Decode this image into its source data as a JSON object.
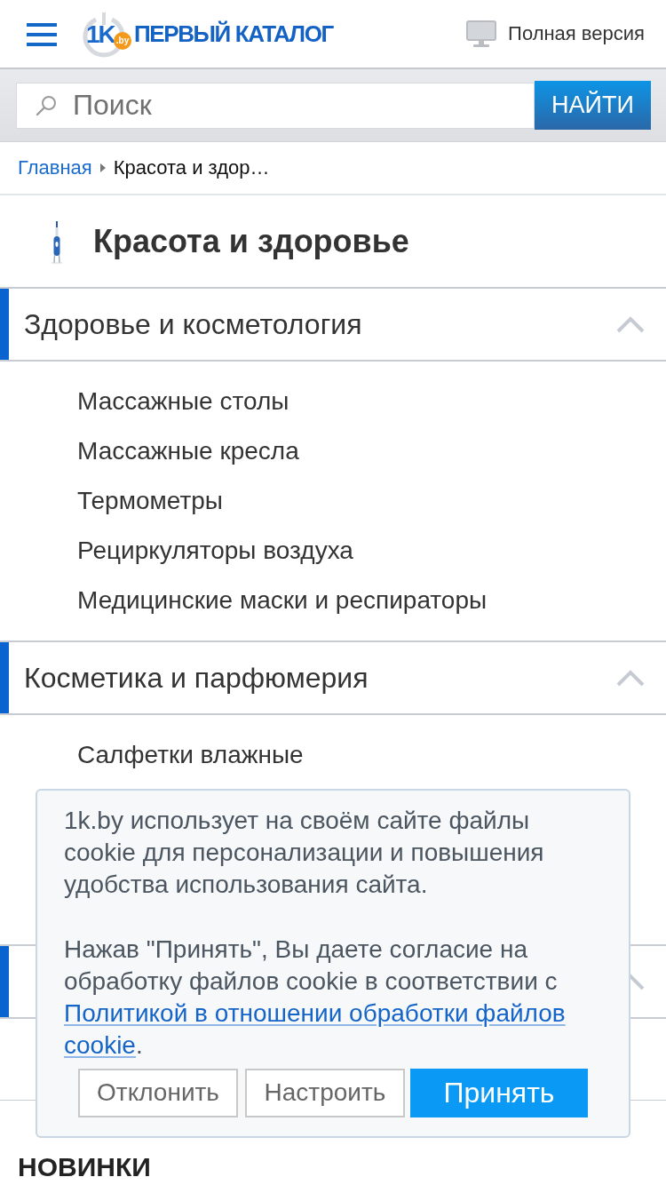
{
  "header": {
    "logo": {
      "mark": "1K",
      "domain": ".by",
      "name": "ПЕРВЫЙ КАТАЛОГ"
    },
    "full_version_link": "Полная версия"
  },
  "search": {
    "placeholder": "Поиск",
    "button": "НАЙТИ"
  },
  "breadcrumbs": [
    {
      "label": "Главная",
      "kind": "link"
    },
    {
      "label": "Красота и здор…",
      "kind": "current"
    }
  ],
  "category": {
    "title": "Красота и здоровье"
  },
  "sections": [
    {
      "title": "Здоровье и косметология",
      "expanded": true,
      "items": [
        "Массажные столы",
        "Массажные кресла",
        "Термометры",
        "Рециркуляторы воздуха",
        "Медицинские маски и респираторы"
      ]
    },
    {
      "title": "Косметика и парфюмерия",
      "expanded": true,
      "items": [
        "Салфетки влажные"
      ]
    },
    {
      "expanded": true
    }
  ],
  "new_arrivals": {
    "title": "НОВИНКИ"
  },
  "cookie_banner": {
    "notice": "1k.by использует на своём сайте файлы cookie для персонализации и повышения удобства использования сайта.",
    "consent": {
      "before": "Нажав \"Принять\", Вы даете согласие на обработку файлов cookie в соответствии с",
      "link": "Политикой в отношении обработки файлов cookie",
      "after": "."
    },
    "buttons": [
      {
        "label": "Отклонить",
        "kind": "secondary"
      },
      {
        "label": "Настроить",
        "kind": "secondary"
      },
      {
        "label": "Принять",
        "kind": "primary"
      }
    ]
  }
}
